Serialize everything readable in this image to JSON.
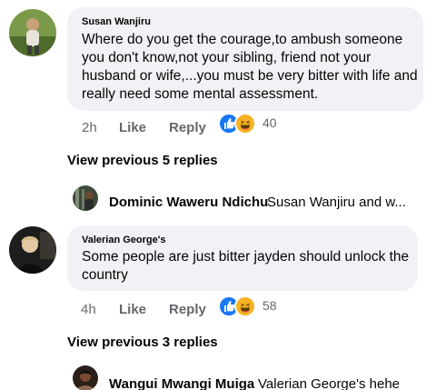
{
  "comments": [
    {
      "author": "Susan Wanjiru",
      "lines": [
        "Where do you get the courage,to ambush someone",
        "you don't know,not your sibling, friend not your",
        "husband or wife,...you must be very bitter with life and",
        "really need some mental assessment."
      ],
      "time": "2h",
      "like_label": "Like",
      "reply_label": "Reply",
      "reaction_count": "40",
      "reaction_icons": [
        "like-icon",
        "haha-icon"
      ],
      "view_previous": "View previous 5 replies",
      "latest_reply": {
        "author": "Dominic Waweru Ndichu",
        "preview": "Susan Wanjiru and w..."
      }
    },
    {
      "author": "Valerian George's",
      "lines": [
        "Some people are just bitter jayden should unlock the",
        "country"
      ],
      "time": "4h",
      "like_label": "Like",
      "reply_label": "Reply",
      "reaction_count": "58",
      "reaction_icons": [
        "like-icon",
        "haha-icon"
      ],
      "view_previous": "View previous 3 replies",
      "latest_reply": {
        "author": "Wangui Mwangi Muiga",
        "preview": "Valerian George's hehe"
      }
    }
  ],
  "colors": {
    "bubble": "#f0f2f5",
    "meta_text": "#65676b",
    "like_blue": "#1877f2",
    "haha_yellow": "#f7b125"
  }
}
